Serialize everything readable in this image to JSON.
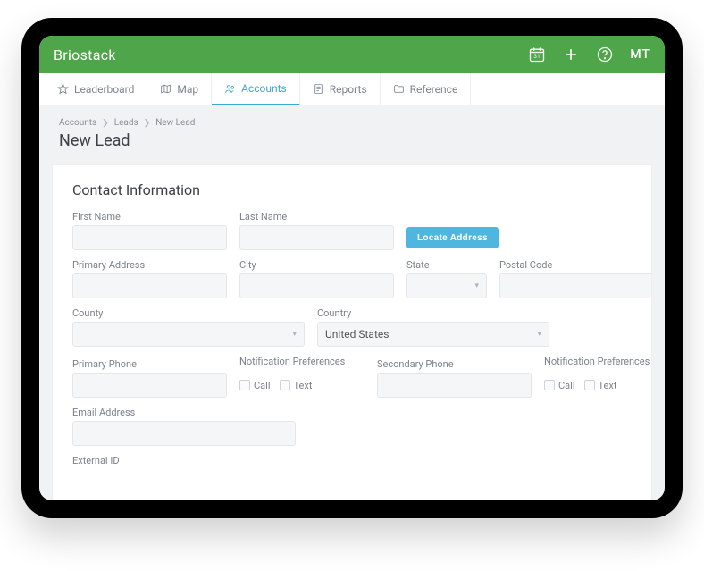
{
  "header": {
    "brand": "Briostack",
    "user_initials": "MT"
  },
  "nav": {
    "tabs": [
      {
        "label": "Leaderboard"
      },
      {
        "label": "Map"
      },
      {
        "label": "Accounts"
      },
      {
        "label": "Reports"
      },
      {
        "label": "Reference"
      }
    ]
  },
  "breadcrumbs": {
    "level1": "Accounts",
    "level2": "Leads",
    "level3": "New Lead"
  },
  "page": {
    "title": "New Lead",
    "section_title": "Contact Information"
  },
  "form": {
    "first_name": {
      "label": "First Name",
      "value": ""
    },
    "last_name": {
      "label": "Last Name",
      "value": ""
    },
    "locate_button": "Locate Address",
    "primary_address": {
      "label": "Primary Address",
      "value": ""
    },
    "city": {
      "label": "City",
      "value": ""
    },
    "state": {
      "label": "State",
      "value": ""
    },
    "postal_code": {
      "label": "Postal Code",
      "value": ""
    },
    "county": {
      "label": "County",
      "value": ""
    },
    "country": {
      "label": "Country",
      "value": "United States"
    },
    "primary_phone": {
      "label": "Primary Phone",
      "value": ""
    },
    "notification_prefs": {
      "label": "Notification Preferences",
      "call": "Call",
      "text": "Text"
    },
    "secondary_phone": {
      "label": "Secondary Phone",
      "value": ""
    },
    "email": {
      "label": "Email Address",
      "value": ""
    },
    "external_id": {
      "label": "External ID",
      "value": ""
    }
  }
}
